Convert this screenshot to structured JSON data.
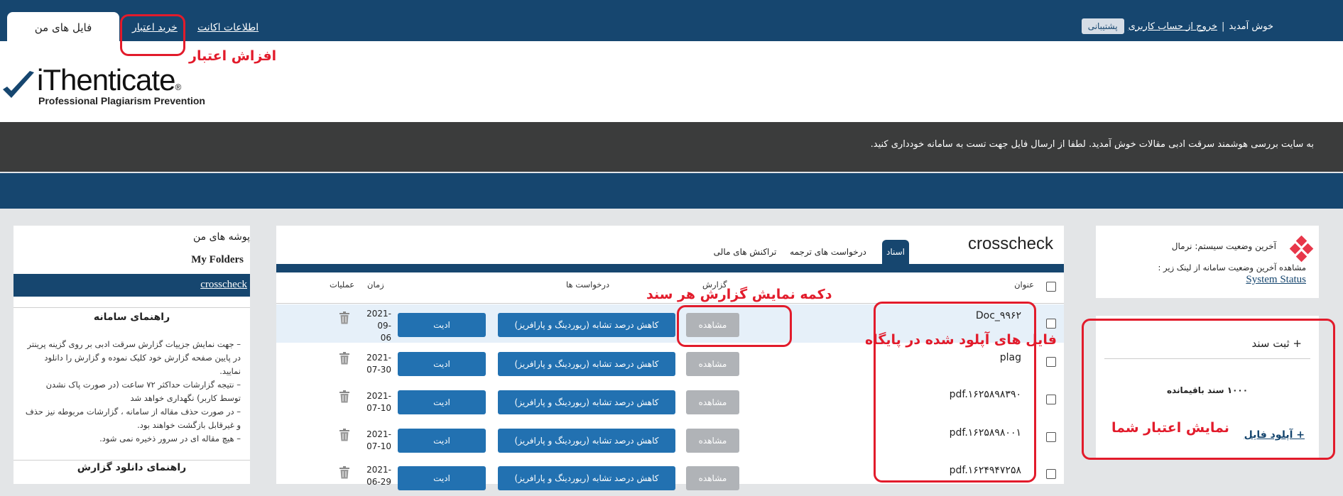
{
  "topnav": {
    "tab_my_files": "فایل های من",
    "buy_credit": "خرید اعتبار",
    "account_info": "اطلاعات اکانت",
    "welcome": "خوش آمدید",
    "separator": "|",
    "logout": "خروج از حساب کاربری",
    "support": "پشتیبانی"
  },
  "logo": {
    "name": "iThenticate",
    "mark": "®",
    "tagline": "Professional Plagiarism Prevention"
  },
  "banner": {
    "message": "به سایت بررسی هوشمند سرقت ادبی مقالات خوش آمدید. لطفا از ارسال فایل جهت تست به سامانه خودداری کنید."
  },
  "sidebar": {
    "title": "پوشه های من",
    "my_folders": "My Folders",
    "active_folder": "crosscheck",
    "guide_title": "راهنمای سامانه",
    "guide_items": [
      "– جهت نمایش جزییات گزارش سرقت ادبی بر روی گزینه پرینتر در پایین صفحه گزارش خود کلیک نموده و گزارش را دانلود نمایید.",
      "– نتیجه گزارشات حداکثر ۷۲ ساعت (در صورت پاک نشدن توسط کاربر) نگهداری خواهد شد",
      "– در صورت حذف مقاله از سامانه ، گزارشات مربوطه نیز حذف و غیرقابل بازگشت خواهند بود.",
      "– هیچ مقاله ای در سرور ذخیره نمی شود."
    ],
    "download_guide_title": "راهنمای دانلود گزارش"
  },
  "main": {
    "title": "crosscheck",
    "tabs": [
      {
        "label": "اسناد"
      },
      {
        "label": "درخواست های ترجمه"
      },
      {
        "label": "تراکنش های مالی"
      }
    ],
    "columns": {
      "title": "عنوان",
      "report": "گزارش",
      "requests": "درخواست ها",
      "time": "زمان",
      "actions": "عملیات"
    },
    "view_label": "مشاهده",
    "reduce_label": "کاهش درصد تشابه (ریوردینگ و پارافریز)",
    "edit_label": "ادیت",
    "rows": [
      {
        "title": "Doc_۹۹۶۲",
        "date1": "2021-",
        "date2": "09-",
        "date3": "06"
      },
      {
        "title": "plag",
        "date1": "2021-",
        "date2": "07-30",
        "date3": ""
      },
      {
        "title": "pdf.۱۶۲۵۸۹۸۳۹۰",
        "date1": "2021-",
        "date2": "07-10",
        "date3": ""
      },
      {
        "title": "pdf.۱۶۲۵۸۹۸۰۰۱",
        "date1": "2021-",
        "date2": "07-10",
        "date3": ""
      },
      {
        "title": "pdf.۱۶۲۴۹۴۷۲۵۸",
        "date1": "2021-",
        "date2": "06-29",
        "date3": ""
      }
    ]
  },
  "status_panel": {
    "status": "آخرین وضعیت سیستم: نرمال",
    "description": "مشاهده آخرین وضعیت سامانه از لینک زیر :",
    "link": "System Status"
  },
  "doc_panel": {
    "title": "+ ثبت سند",
    "credit": "۱۰۰۰ سند باقیمانده",
    "upload": "+ آپلود فایل"
  },
  "annotations": {
    "credit_increase": "افزاش اعتبار",
    "report_button": "دکمه نمایش گزارش هر سند",
    "uploaded_files": "فایل های آپلود شده در پایگاه",
    "credit_display": "نمایش اعتبار شما"
  },
  "colors": {
    "nav_blue": "#16466f",
    "button_blue": "#2271b1",
    "view_gray": "#b0b3b7",
    "annotation_red": "#e21b2b",
    "banner_dark": "#3b3c3c"
  }
}
